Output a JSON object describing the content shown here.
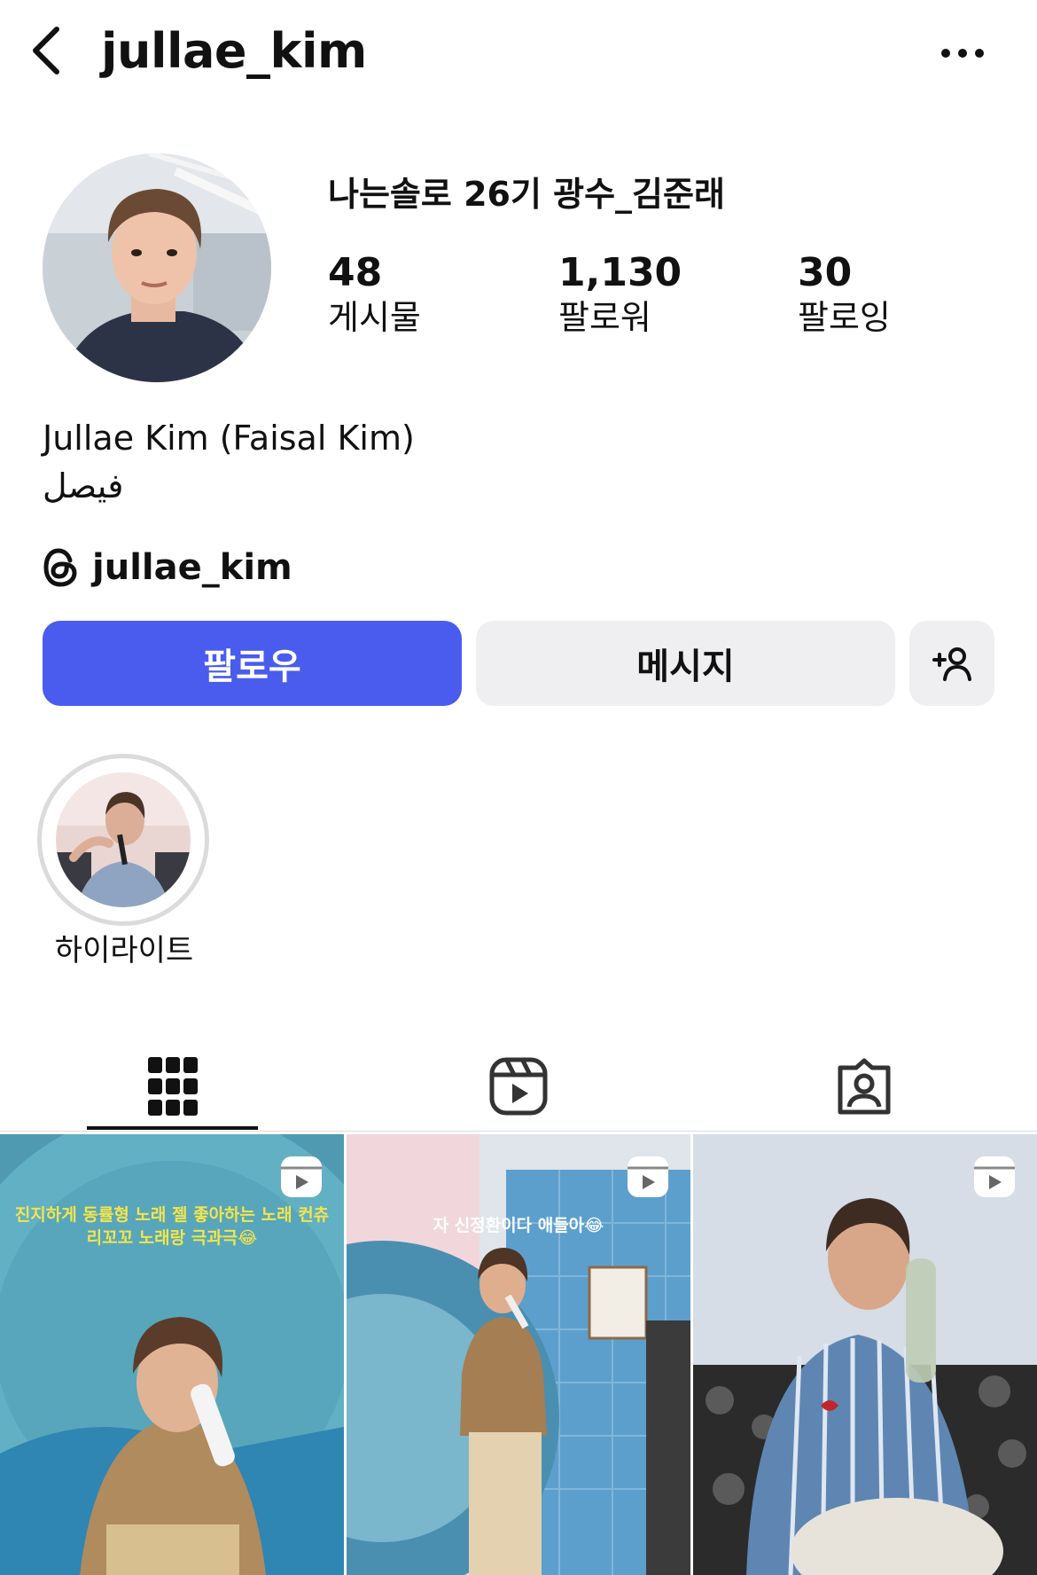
{
  "header": {
    "username": "jullae_kim",
    "back_icon": "chevron-left-icon",
    "more_icon": "ellipsis-icon"
  },
  "profile": {
    "display_name": "나는솔로 26기 광수_김준래",
    "stats": {
      "posts_count": "48",
      "posts_label": "게시물",
      "followers_count": "1,130",
      "followers_label": "팔로워",
      "following_count": "30",
      "following_label": "팔로잉"
    },
    "full_name": "Jullae Kim (Faisal Kim)",
    "bio": "فيصل",
    "threads_handle": "jullae_kim"
  },
  "actions": {
    "follow_label": "팔로우",
    "message_label": "메시지",
    "suggest_icon": "add-person-icon",
    "follow_color": "#4A5CEE"
  },
  "highlights": [
    {
      "label": "하이라이트"
    }
  ],
  "tabs": [
    {
      "name": "grid",
      "icon": "grid-icon",
      "active": true
    },
    {
      "name": "reels",
      "icon": "reels-icon",
      "active": false
    },
    {
      "name": "tagged",
      "icon": "tagged-icon",
      "active": false
    }
  ],
  "posts": [
    {
      "type": "reel",
      "caption": "진지하게 동률형 노래 젤 좋아하는 노래 컨츄 리꼬꼬 노래랑 극과극😂"
    },
    {
      "type": "reel",
      "caption": "자 신정환이다 애들아😂"
    },
    {
      "type": "reel",
      "caption": ""
    }
  ]
}
